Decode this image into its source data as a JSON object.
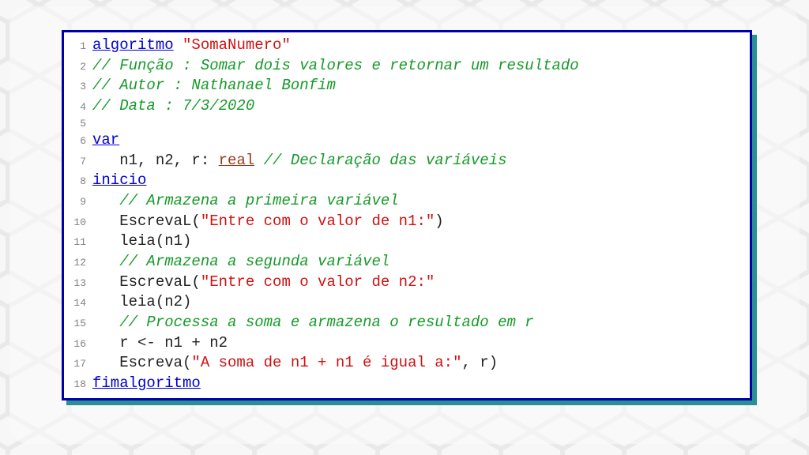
{
  "code": {
    "lines": [
      {
        "num": "1",
        "tokens": [
          {
            "cls": "kw",
            "t": "algoritmo"
          },
          {
            "cls": "txt",
            "t": " "
          },
          {
            "cls": "str",
            "t": "\"SomaNumero\""
          }
        ]
      },
      {
        "num": "2",
        "tokens": [
          {
            "cls": "cmt",
            "t": "// Função : Somar dois valores e retornar um resultado"
          }
        ]
      },
      {
        "num": "3",
        "tokens": [
          {
            "cls": "cmt",
            "t": "// Autor : Nathanael Bonfim"
          }
        ]
      },
      {
        "num": "4",
        "tokens": [
          {
            "cls": "cmt",
            "t": "// Data : 7/3/2020"
          }
        ]
      },
      {
        "num": "5",
        "tokens": [
          {
            "cls": "txt",
            "t": ""
          }
        ]
      },
      {
        "num": "6",
        "tokens": [
          {
            "cls": "kw",
            "t": "var"
          }
        ]
      },
      {
        "num": "7",
        "tokens": [
          {
            "cls": "txt",
            "t": "   n1, n2, r: "
          },
          {
            "cls": "type",
            "t": "real"
          },
          {
            "cls": "txt",
            "t": " "
          },
          {
            "cls": "cmt",
            "t": "// Declaração das variáveis"
          }
        ]
      },
      {
        "num": "8",
        "tokens": [
          {
            "cls": "kw",
            "t": "inicio"
          }
        ]
      },
      {
        "num": "9",
        "tokens": [
          {
            "cls": "txt",
            "t": "   "
          },
          {
            "cls": "cmt",
            "t": "// Armazena a primeira variável"
          }
        ]
      },
      {
        "num": "10",
        "tokens": [
          {
            "cls": "txt",
            "t": "   EscrevaL("
          },
          {
            "cls": "str",
            "t": "\"Entre com o valor de n1:\""
          },
          {
            "cls": "txt",
            "t": ")"
          }
        ]
      },
      {
        "num": "11",
        "tokens": [
          {
            "cls": "txt",
            "t": "   leia(n1)"
          }
        ]
      },
      {
        "num": "12",
        "tokens": [
          {
            "cls": "txt",
            "t": "   "
          },
          {
            "cls": "cmt",
            "t": "// Armazena a segunda variável"
          }
        ]
      },
      {
        "num": "13",
        "tokens": [
          {
            "cls": "txt",
            "t": "   EscrevaL("
          },
          {
            "cls": "str",
            "t": "\"Entre com o valor de n2:\""
          }
        ]
      },
      {
        "num": "14",
        "tokens": [
          {
            "cls": "txt",
            "t": "   leia(n2)"
          }
        ]
      },
      {
        "num": "15",
        "tokens": [
          {
            "cls": "txt",
            "t": "   "
          },
          {
            "cls": "cmt",
            "t": "// Processa a soma e armazena o resultado em r"
          }
        ]
      },
      {
        "num": "16",
        "tokens": [
          {
            "cls": "txt",
            "t": "   r <- n1 + n2"
          }
        ]
      },
      {
        "num": "17",
        "tokens": [
          {
            "cls": "txt",
            "t": "   Escreva("
          },
          {
            "cls": "str",
            "t": "\"A soma de n1 + n1 é igual a:\""
          },
          {
            "cls": "txt",
            "t": ", r)"
          }
        ]
      },
      {
        "num": "18",
        "tokens": [
          {
            "cls": "kw",
            "t": "fimalgoritmo"
          }
        ]
      }
    ]
  }
}
